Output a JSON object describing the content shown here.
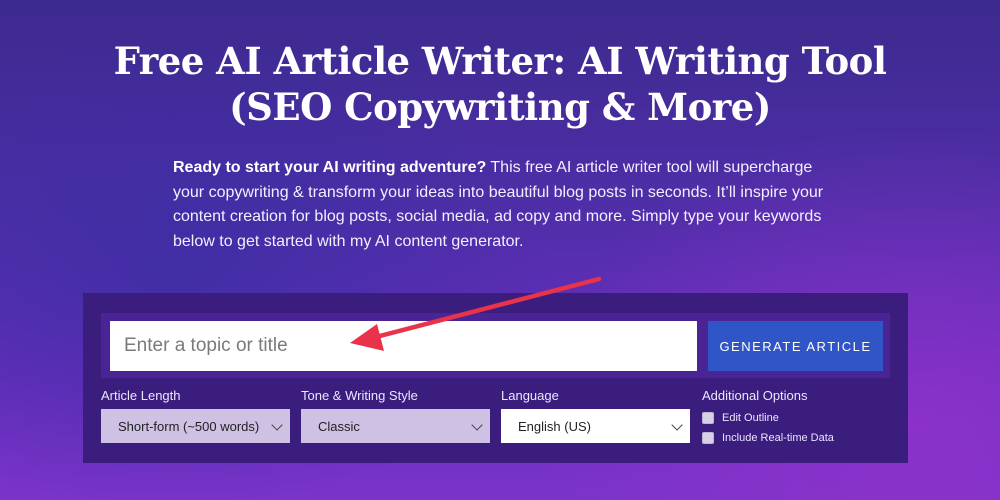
{
  "header": {
    "title_line1": "Free AI Article Writer: AI Writing Tool",
    "title_line2": "(SEO Copywriting & More)"
  },
  "intro": {
    "lead": "Ready to start your AI writing adventure?",
    "body": " This free AI article writer tool will supercharge your copywriting & transform your ideas into beautiful blog posts in seconds. It’ll inspire your content creation for blog posts, social media, ad copy and more. Simply type your keywords below to get started with my AI content generator."
  },
  "form": {
    "topic_input": {
      "placeholder": "Enter a topic or title",
      "value": ""
    },
    "generate_label": "GENERATE ARTICLE",
    "article_length": {
      "label": "Article Length",
      "selected": "Short-form (~500 words)"
    },
    "tone": {
      "label": "Tone & Writing Style",
      "selected": "Classic"
    },
    "language": {
      "label": "Language",
      "selected": "English (US)"
    },
    "additional_options": {
      "label": "Additional Options",
      "edit_outline": {
        "label": "Edit Outline",
        "checked": false
      },
      "realtime_data": {
        "label": "Include Real-time Data",
        "checked": false
      }
    }
  },
  "colors": {
    "button": "#2f55c6",
    "panel": "#3b1d7e",
    "annotation_arrow": "#e8334a"
  },
  "icons": [
    "chevron-down-icon",
    "arrow-annotation-icon"
  ]
}
